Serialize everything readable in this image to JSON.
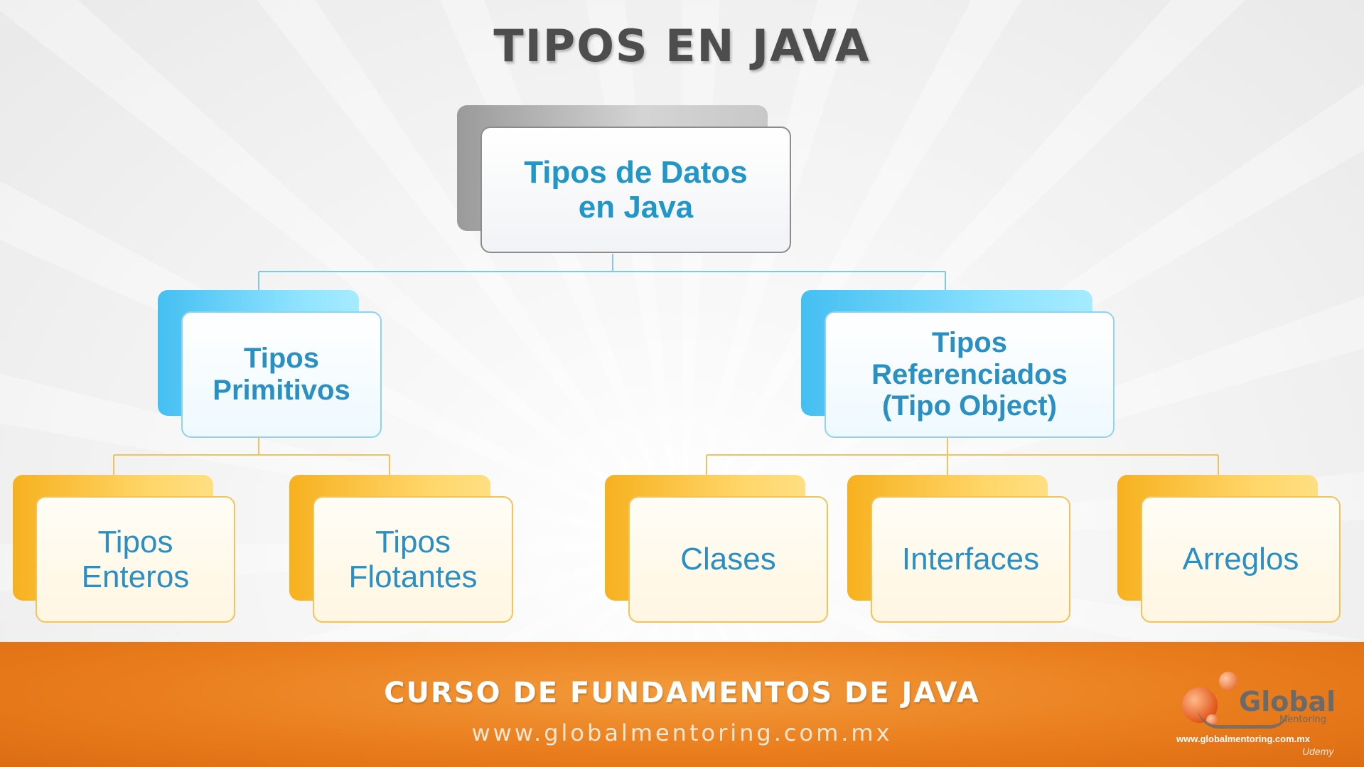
{
  "title": "TIPOS EN JAVA",
  "diagram": {
    "root": {
      "label_lines": [
        "Tipos de Datos",
        "en Java"
      ]
    },
    "primitive": {
      "label_lines": [
        "Tipos",
        "Primitivos"
      ]
    },
    "reference": {
      "label_lines": [
        "Tipos",
        "Referenciados",
        "(Tipo Object)"
      ]
    },
    "enteros": {
      "label_lines": [
        "Tipos",
        "Enteros"
      ]
    },
    "flotantes": {
      "label_lines": [
        "Tipos",
        "Flotantes"
      ]
    },
    "clases": {
      "label": "Clases"
    },
    "interfaces": {
      "label": "Interfaces"
    },
    "arreglos": {
      "label": "Arreglos"
    }
  },
  "colors": {
    "node_text": "#2a8fc3",
    "level2_accent": "#44bff2",
    "level3_accent": "#f7b11f",
    "footer": "#ea7e1e"
  },
  "footer": {
    "course": "CURSO DE FUNDAMENTOS DE JAVA",
    "url": "www.globalmentoring.com.mx"
  },
  "logo": {
    "brand": "Global",
    "sub": "Mentoring",
    "url": "www.globalmentoring.com.mx"
  },
  "watermark": "Udemy"
}
